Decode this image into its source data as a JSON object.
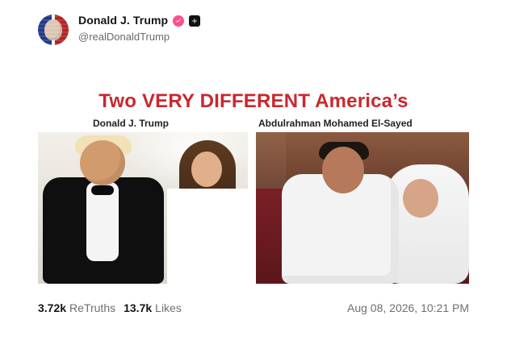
{
  "post": {
    "author": {
      "name": "Donald J. Trump",
      "handle": "@realDonaldTrump",
      "avatar_icon": "profile-avatar",
      "badges": {
        "verified_icon": "verified-check-icon",
        "extra_icon": "plus-badge-icon"
      }
    },
    "media": {
      "headline": "Two VERY DIFFERENT America’s",
      "left_label": "Donald J. Trump",
      "right_label": "Abdulrahman Mohamed El-Sayed"
    },
    "stats": {
      "retruths_value": "3.72k",
      "retruths_label": "ReTruths",
      "likes_value": "13.7k",
      "likes_label": "Likes"
    },
    "timestamp": "Aug 08, 2026, 10:21 PM"
  },
  "colors": {
    "headline_red": "#c9282d",
    "verified_pink": "#ff4f8a"
  }
}
